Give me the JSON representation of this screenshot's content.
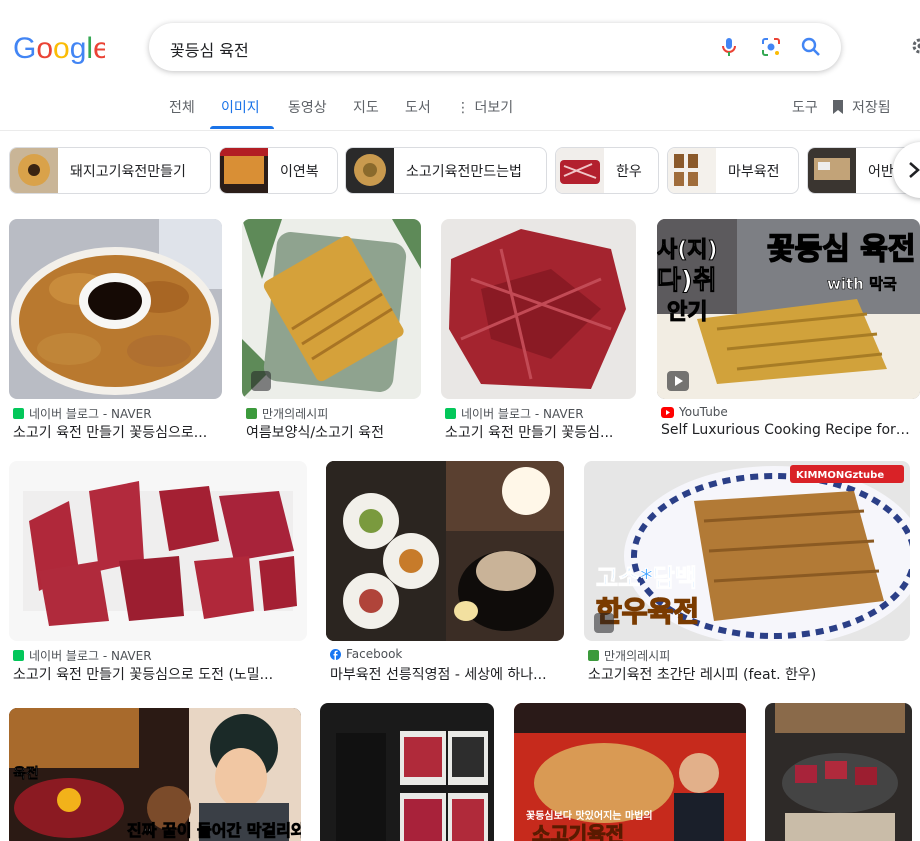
{
  "logo": {
    "text": "Google",
    "colors": [
      "#4285f4",
      "#ea4335",
      "#fbbc05",
      "#4285f4",
      "#34a853",
      "#ea4335"
    ]
  },
  "search": {
    "query": "꽃등심 육전"
  },
  "tabs": [
    {
      "label": "전체"
    },
    {
      "label": "이미지",
      "active": true
    },
    {
      "label": "동영상"
    },
    {
      "label": "지도"
    },
    {
      "label": "도서"
    },
    {
      "label": "⋮ 더보기"
    }
  ],
  "tools": {
    "label": "도구",
    "saved_label": "저장됨"
  },
  "chips": [
    {
      "label": "돼지고기육전만들기"
    },
    {
      "label": "이연복"
    },
    {
      "label": "소고기육전만드는법"
    },
    {
      "label": "한우"
    },
    {
      "label": "마부육전"
    },
    {
      "label": "어반"
    }
  ],
  "results": [
    {
      "source": "네이버 블로그 - NAVER",
      "source_icon": "naver-blog-icon",
      "title": "소고기 육전 만들기 꽃등심으로..."
    },
    {
      "source": "만개의레시피",
      "source_icon": "recipe-site-icon",
      "title": "여름보양식/소고기 육전"
    },
    {
      "source": "네이버 블로그 - NAVER",
      "source_icon": "naver-blog-icon",
      "title": "소고기 육전 만들기 꽃등심..."
    },
    {
      "source": "YouTube",
      "source_icon": "youtube-icon",
      "title": "Self Luxurious Cooking Recipe for Li...",
      "overlay_1": "꽃등심 육전",
      "overlay_2": "with 막국",
      "overlay_3": "사(지)",
      "overlay_4": "다)취",
      "overlay_5": "안기"
    },
    {
      "source": "네이버 블로그 - NAVER",
      "source_icon": "naver-blog-icon",
      "title": "소고기 육전 만들기 꽃등심으로 도전 (노밀..."
    },
    {
      "source": "Facebook",
      "source_icon": "facebook-icon",
      "title": "마부육전 선릉직영점 - 세상에 하나..."
    },
    {
      "source": "만개의레시피",
      "source_icon": "recipe-site-icon",
      "title": "소고기육전 초간단 레시피 (feat. 한우)",
      "overlay_1": "고소*담백",
      "overlay_2": "한우육전",
      "overlay_3": "KIMMONGztube"
    },
    {
      "overlay_1": "육전",
      "overlay_2": "진짜 꿀이 들어간 막걸리와!"
    },
    {},
    {
      "overlay_1": "꽃등심보다 맛있어지는 마법의",
      "overlay_2": "소고기육전"
    },
    {}
  ],
  "colors": {
    "accent": "#1a73e8",
    "naver": "#03c75a",
    "youtube": "#ff0000",
    "facebook": "#1877f2",
    "recipe": "#3c9a3c"
  }
}
